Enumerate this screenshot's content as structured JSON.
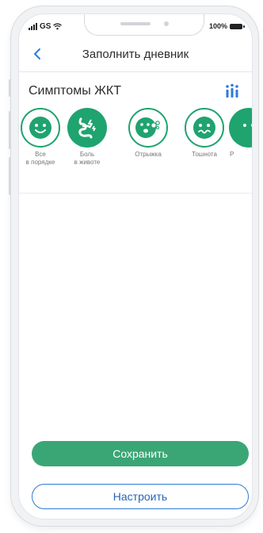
{
  "status_bar": {
    "carrier": "GS",
    "battery": "100%"
  },
  "header": {
    "title": "Заполнить дневник",
    "back_icon": "chevron-left-icon"
  },
  "section": {
    "title": "Симптомы ЖКТ",
    "stats_icon": "bar-chart-icon"
  },
  "symptoms": [
    {
      "label_line1": "Все",
      "label_line2": "в порядке",
      "icon": "smile-face-icon",
      "selected": false
    },
    {
      "label_line1": "Боль",
      "label_line2": "в животе",
      "icon": "intestine-pain-icon",
      "selected": true
    },
    {
      "label_line1": "Отрыжка",
      "label_line2": "",
      "icon": "burp-face-icon",
      "selected": false
    },
    {
      "label_line1": "Тошнота",
      "label_line2": "",
      "icon": "nausea-face-icon",
      "selected": false
    },
    {
      "label_line1": "Р",
      "label_line2": "",
      "icon": "face-icon",
      "selected": true
    }
  ],
  "buttons": {
    "save": "Сохранить",
    "configure": "Настроить"
  },
  "colors": {
    "accent_green": "#1fa36f",
    "save_button": "#3aa676",
    "configure_border": "#2e7bd6",
    "stats_icon": "#2e7bd6"
  }
}
